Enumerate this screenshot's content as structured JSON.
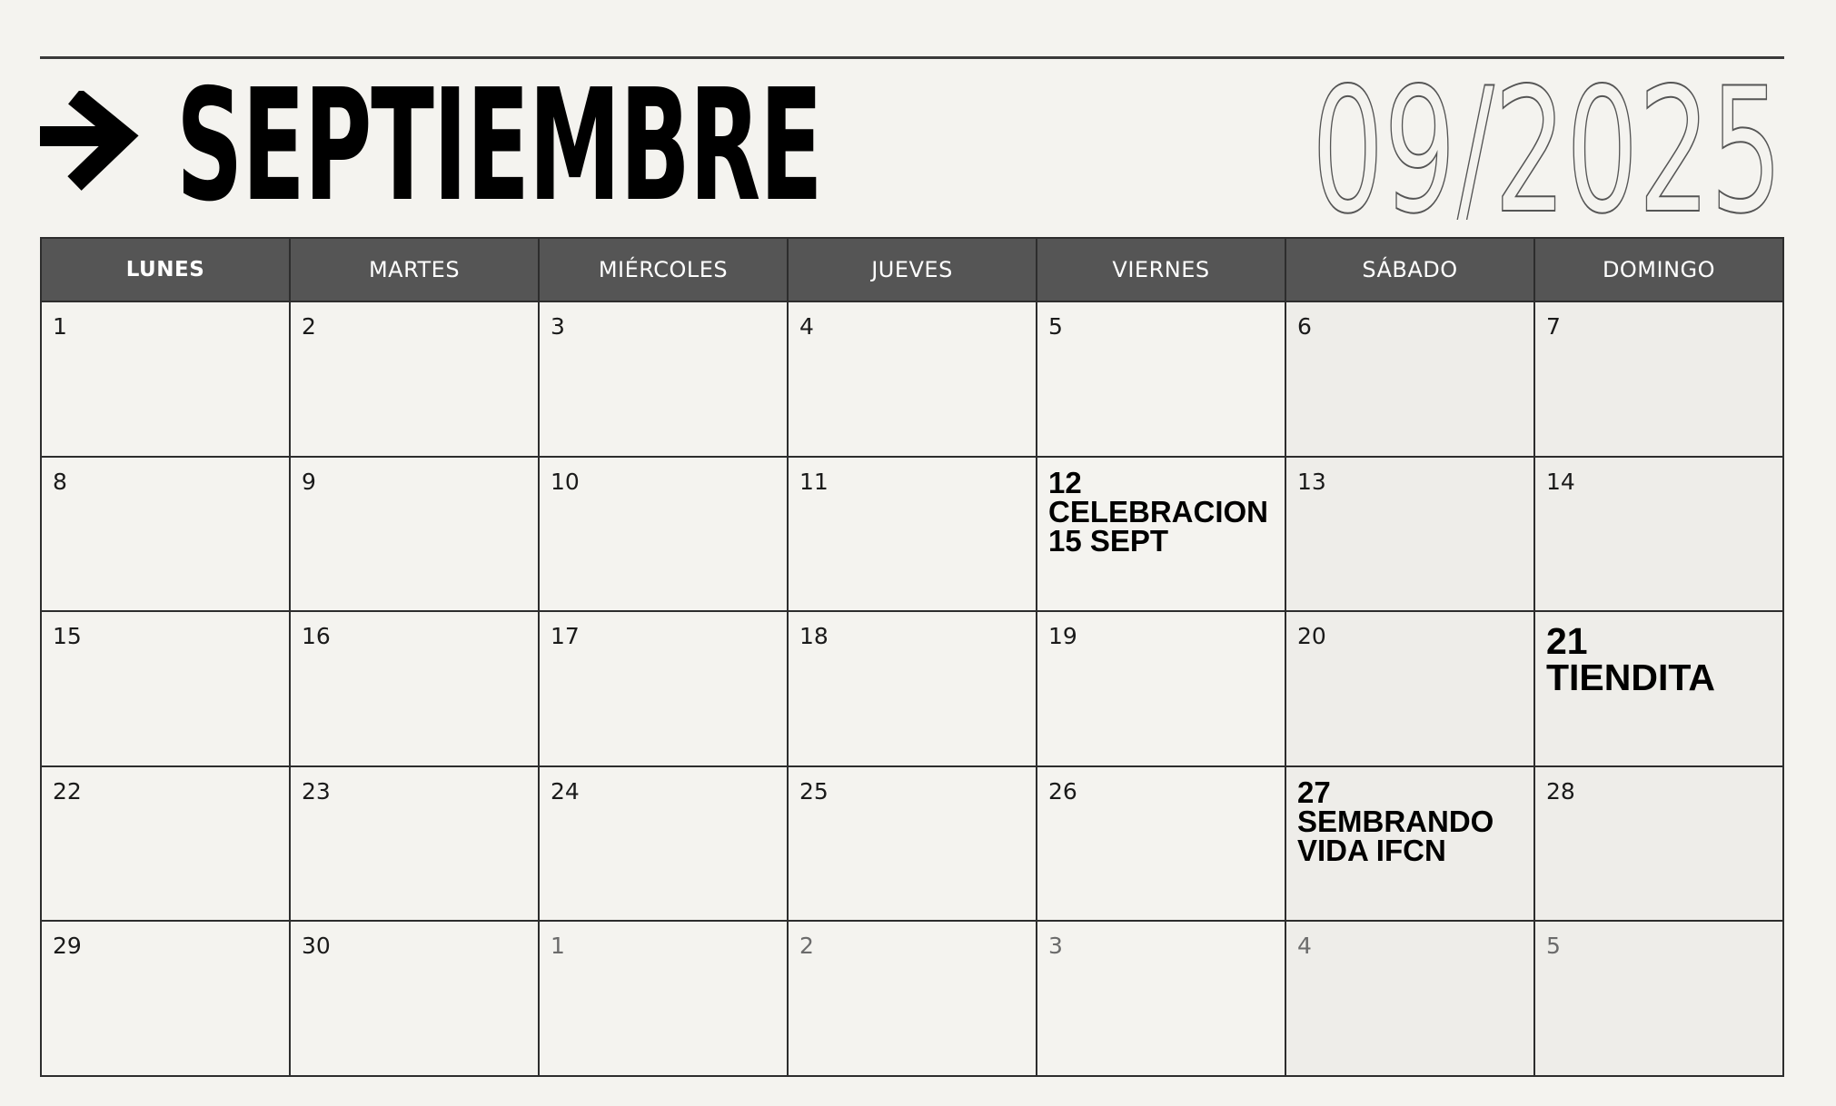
{
  "header": {
    "month": "SEPTIEMBRE",
    "date": "09/2025"
  },
  "weekdays": [
    "LUNES",
    "MARTES",
    "MIÉRCOLES",
    "JUEVES",
    "VIERNES",
    "SÁBADO",
    "DOMINGO"
  ],
  "weeks": [
    [
      {
        "day": "1"
      },
      {
        "day": "2"
      },
      {
        "day": "3"
      },
      {
        "day": "4"
      },
      {
        "day": "5"
      },
      {
        "day": "6"
      },
      {
        "day": "7"
      }
    ],
    [
      {
        "day": "8"
      },
      {
        "day": "9"
      },
      {
        "day": "10"
      },
      {
        "day": "11"
      },
      {
        "day": "12",
        "event": [
          "CELEBRACION",
          "15 SEPT"
        ]
      },
      {
        "day": "13"
      },
      {
        "day": "14"
      }
    ],
    [
      {
        "day": "15"
      },
      {
        "day": "16"
      },
      {
        "day": "17"
      },
      {
        "day": "18"
      },
      {
        "day": "19"
      },
      {
        "day": "20"
      },
      {
        "day": "21",
        "event": [
          "TIENDITA"
        ]
      }
    ],
    [
      {
        "day": "22"
      },
      {
        "day": "23"
      },
      {
        "day": "24"
      },
      {
        "day": "25"
      },
      {
        "day": "26"
      },
      {
        "day": "27",
        "event": [
          "SEMBRANDO",
          "VIDA IFCN"
        ]
      },
      {
        "day": "28"
      }
    ],
    [
      {
        "day": "29"
      },
      {
        "day": "30"
      },
      {
        "day": "1",
        "other": true
      },
      {
        "day": "2",
        "other": true
      },
      {
        "day": "3",
        "other": true
      },
      {
        "day": "4",
        "other": true
      },
      {
        "day": "5",
        "other": true
      }
    ]
  ],
  "icons": {
    "arrow": "arrow-right-icon"
  },
  "colors": {
    "background": "#f4f3ef",
    "header_bar": "#555555",
    "weekend_cell": "#eeede9",
    "grid_line": "#2d2d2d"
  }
}
